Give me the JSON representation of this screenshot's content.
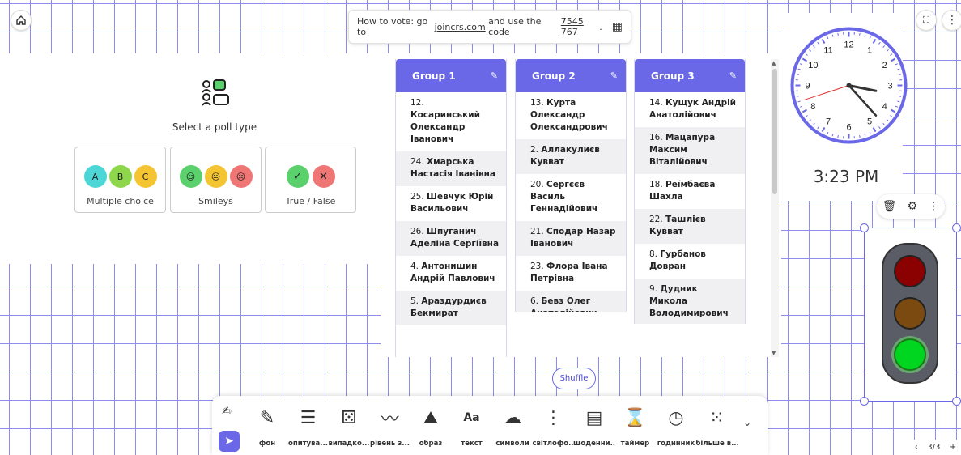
{
  "vote": {
    "prefix": "How to vote: go to",
    "site": "joincrs.com",
    "middle": "and use the code",
    "code": "7545 767",
    "suffix": "."
  },
  "poll": {
    "title": "Select a poll type",
    "cards": [
      {
        "label": "Multiple choice",
        "circles": [
          "A",
          "B",
          "C"
        ],
        "colors": [
          "#4dd6d6",
          "#8ed64a",
          "#f5c431"
        ]
      },
      {
        "label": "Smileys",
        "colors": [
          "#5bd16e",
          "#f5c431",
          "#f07575"
        ]
      },
      {
        "label": "True / False",
        "colors": [
          "#5bd16e",
          "#f07575"
        ]
      }
    ]
  },
  "groups": [
    {
      "title": "Group 1",
      "members": [
        {
          "num": "12.",
          "name": "Косаринський Олександр Іванович"
        },
        {
          "num": "24.",
          "name": "Хмарська Настасія Іванівна"
        },
        {
          "num": "25.",
          "name": "Шевчук Юрій Васильович"
        },
        {
          "num": "26.",
          "name": "Шпуганич Аделіна Сергіївна"
        },
        {
          "num": "4.",
          "name": "Антонишин Андрій Павлович"
        },
        {
          "num": "5.",
          "name": "Араздурдиєв Бекмират"
        }
      ]
    },
    {
      "title": "Group 2",
      "members": [
        {
          "num": "13.",
          "name": "Курта Олександр Олександрович"
        },
        {
          "num": "2.",
          "name": "Аллакулиєв Кувват"
        },
        {
          "num": "20.",
          "name": "Сергєєв Василь Геннадійович"
        },
        {
          "num": "21.",
          "name": "Сподар Назар Іванович"
        },
        {
          "num": "23.",
          "name": "Флора Івана Петрівна"
        },
        {
          "num": "6.",
          "name": "Бевз Олег Анатолійович"
        }
      ]
    },
    {
      "title": "Group 3",
      "members": [
        {
          "num": "14.",
          "name": "Кущук Андрій Анатолійович"
        },
        {
          "num": "16.",
          "name": "Мацапура Максим Віталійович"
        },
        {
          "num": "18.",
          "name": "Реїмбаєва Шахла"
        },
        {
          "num": "22.",
          "name": "Ташлієв Кувват"
        },
        {
          "num": "8.",
          "name": "Гурбанов Довран"
        },
        {
          "num": "9.",
          "name": "Дудник Микола Володимирович"
        }
      ]
    }
  ],
  "shuffle_label": "Shuffle",
  "clock": {
    "time": "3:23 PM",
    "numbers": [
      "12",
      "1",
      "2",
      "3",
      "4",
      "5",
      "6",
      "7",
      "8",
      "9",
      "10",
      "11"
    ],
    "hour": 3,
    "minute": 23,
    "second": 42
  },
  "toolbar": {
    "items": [
      {
        "label": "фон",
        "icon": "background-icon"
      },
      {
        "label": "опитува...",
        "icon": "poll-icon"
      },
      {
        "label": "випадко...",
        "icon": "random-icon"
      },
      {
        "label": "рівень з...",
        "icon": "noise-level-icon"
      },
      {
        "label": "образ",
        "icon": "image-icon"
      },
      {
        "label": "текст",
        "icon": "text-icon"
      },
      {
        "label": "символи",
        "icon": "symbols-icon"
      },
      {
        "label": "світлофо...",
        "icon": "traffic-light-icon"
      },
      {
        "label": "щоденни...",
        "icon": "schedule-icon"
      },
      {
        "label": "таймер",
        "icon": "timer-icon"
      },
      {
        "label": "годинник",
        "icon": "clock-icon"
      },
      {
        "label": "більше в...",
        "icon": "more-apps-icon"
      }
    ]
  },
  "pager": {
    "prev": "‹",
    "text": "3/3",
    "next": "+"
  },
  "colors": {
    "accent": "#6a68e6",
    "grid": "#8f8cf0",
    "red_light": "#8b0000",
    "amber_light": "#7a4a10",
    "green_light": "#00d61f"
  }
}
